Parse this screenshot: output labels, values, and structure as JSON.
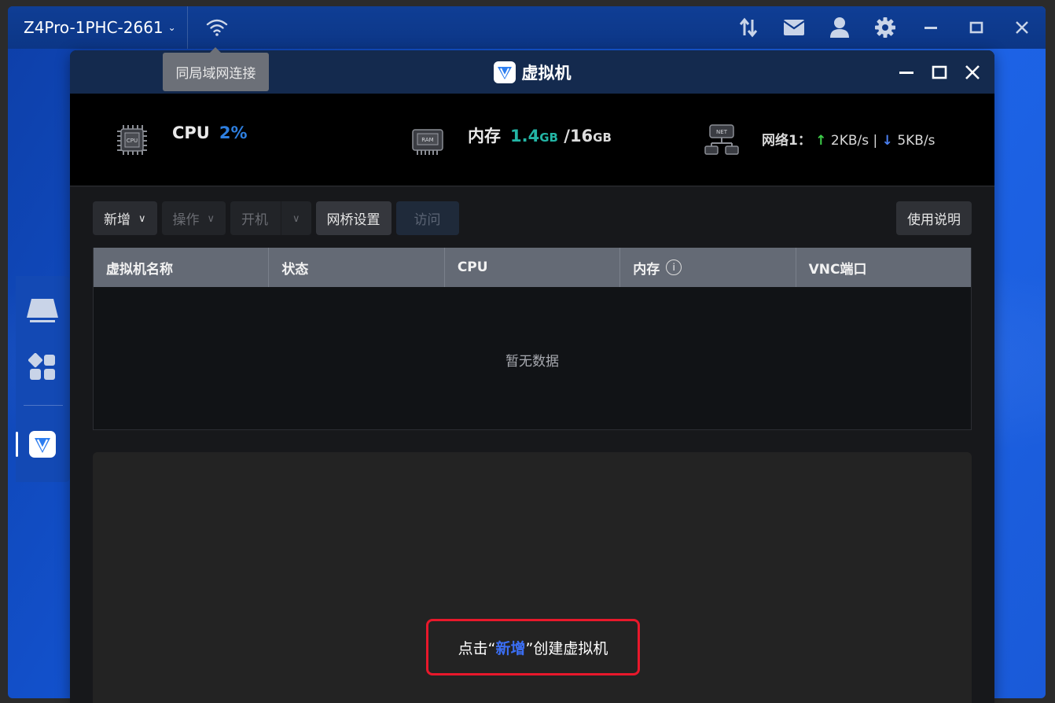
{
  "topbar": {
    "device_name": "Z4Pro-1PHC-2661",
    "tooltip": "同局域网连接"
  },
  "window": {
    "title": "虚拟机"
  },
  "stats": {
    "cpu": {
      "label": "CPU",
      "value": "2%",
      "percent": 2
    },
    "memory": {
      "label": "内存",
      "used": "1.4",
      "used_unit": "GB",
      "separator": "/",
      "total": "16",
      "total_unit": "GB",
      "percent": 9
    },
    "network": {
      "label": "网络1：",
      "up_arrow": "↑",
      "up": "2KB/s",
      "divider": "|",
      "down_arrow": "↓",
      "down": "5KB/s"
    }
  },
  "toolbar": {
    "add": "新增",
    "operate": "操作",
    "power_on": "开机",
    "bridge_settings": "网桥设置",
    "visit": "访问",
    "help": "使用说明"
  },
  "table": {
    "columns": [
      "虚拟机名称",
      "状态",
      "CPU",
      "内存",
      "VNC端口"
    ],
    "info_glyph": "i",
    "empty_text": "暂无数据"
  },
  "hint": {
    "prefix": "点击“",
    "highlight": "新增",
    "suffix": "”创建虚拟机"
  },
  "colors": {
    "accent_blue": "#2e7fe0",
    "memory_teal": "#23b5a5",
    "upload_green": "#3ecf4a",
    "download_blue": "#4a7ff0",
    "hint_border": "#e8182b"
  }
}
